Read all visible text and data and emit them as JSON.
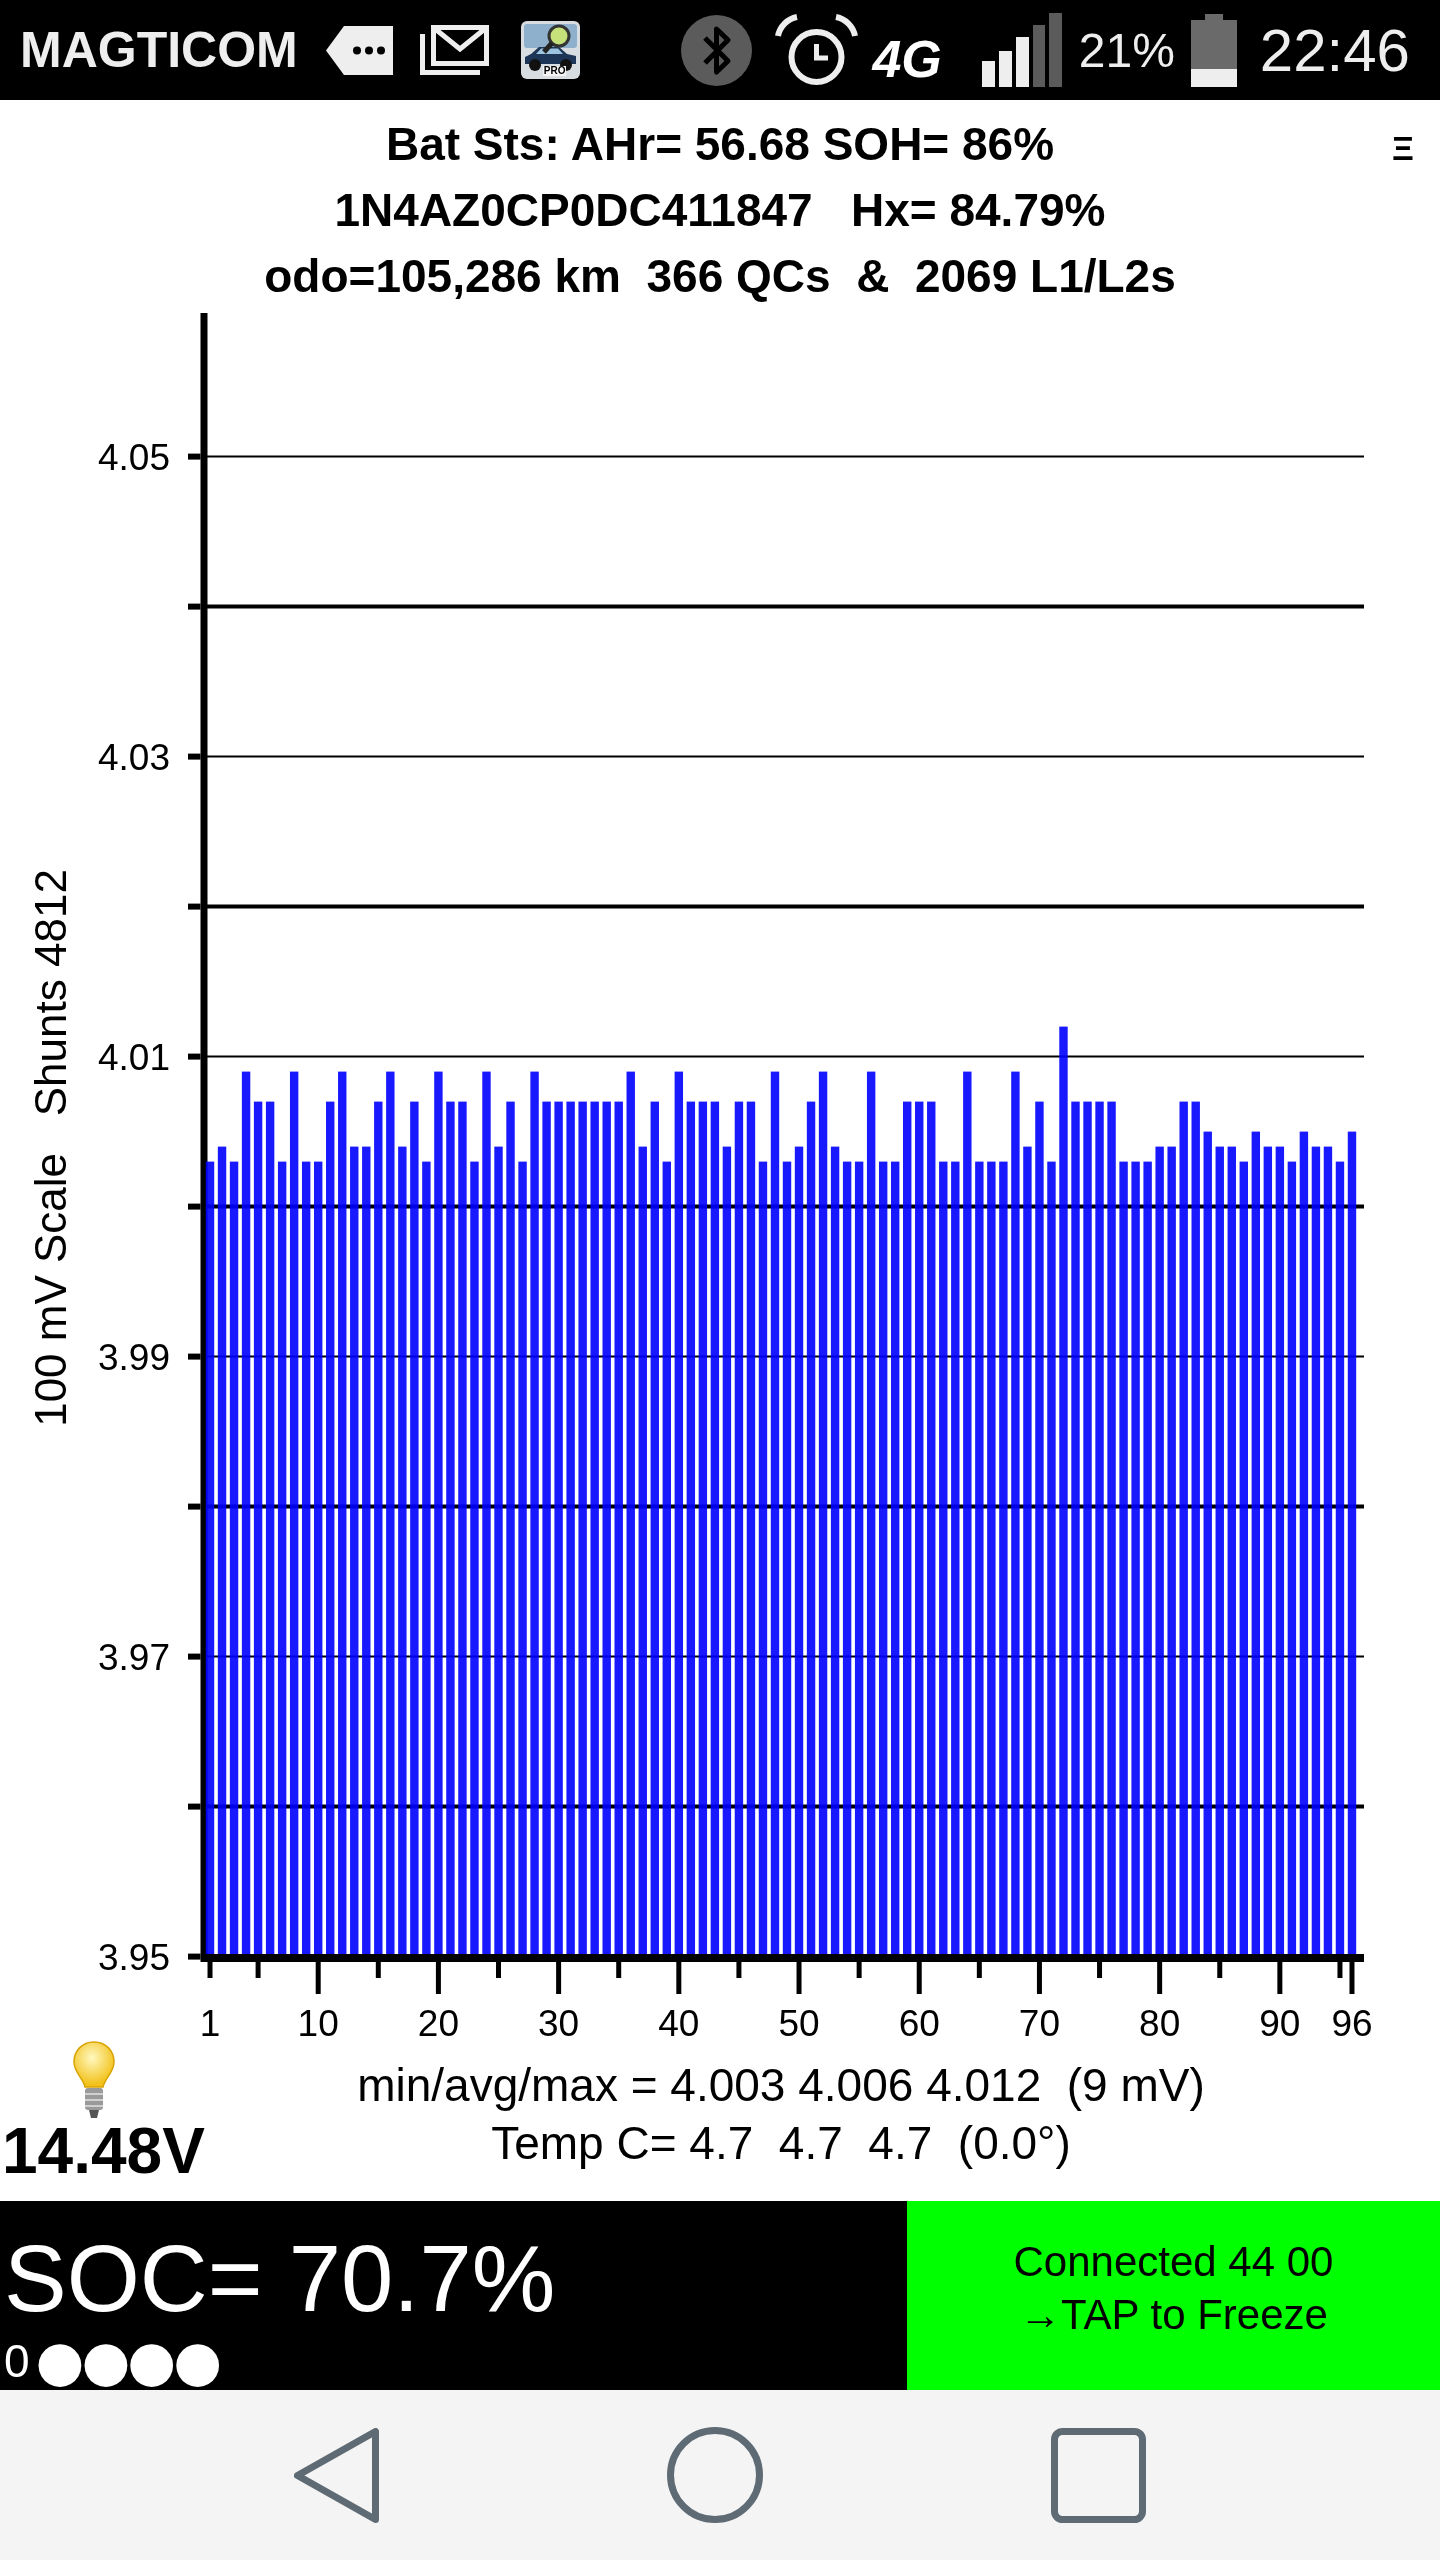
{
  "status_bar": {
    "carrier": "MAGTICOM",
    "app_badge": "PRO",
    "network": "4G",
    "battery": "21%",
    "time": "22:46"
  },
  "header": {
    "battery_status": "Bat Sts: AHr= 56.68 SOH= 86%",
    "vin_line": "1N4AZ0CP0DC411847   Hx= 84.79%",
    "odometer_line": "odo=105,286 km  366 QCs  &  2069 L1/L2s",
    "menu_glyph": "Ξ"
  },
  "chart": {
    "chart_data": {
      "type": "bar",
      "ylabel": "100 mV Scale   Shunts 4812",
      "x": [
        1,
        2,
        3,
        4,
        5,
        6,
        7,
        8,
        9,
        10,
        11,
        12,
        13,
        14,
        15,
        16,
        17,
        18,
        19,
        20,
        21,
        22,
        23,
        24,
        25,
        26,
        27,
        28,
        29,
        30,
        31,
        32,
        33,
        34,
        35,
        36,
        37,
        38,
        39,
        40,
        41,
        42,
        43,
        44,
        45,
        46,
        47,
        48,
        49,
        50,
        51,
        52,
        53,
        54,
        55,
        56,
        57,
        58,
        59,
        60,
        61,
        62,
        63,
        64,
        65,
        66,
        67,
        68,
        69,
        70,
        71,
        72,
        73,
        74,
        75,
        76,
        77,
        78,
        79,
        80,
        81,
        82,
        83,
        84,
        85,
        86,
        87,
        88,
        89,
        90,
        91,
        92,
        93,
        94,
        95,
        96
      ],
      "values": [
        4.003,
        4.004,
        4.003,
        4.009,
        4.007,
        4.007,
        4.003,
        4.009,
        4.003,
        4.003,
        4.007,
        4.009,
        4.004,
        4.004,
        4.007,
        4.009,
        4.004,
        4.007,
        4.003,
        4.009,
        4.007,
        4.007,
        4.003,
        4.009,
        4.004,
        4.007,
        4.003,
        4.009,
        4.007,
        4.007,
        4.007,
        4.007,
        4.007,
        4.007,
        4.007,
        4.009,
        4.004,
        4.007,
        4.003,
        4.009,
        4.007,
        4.007,
        4.007,
        4.004,
        4.007,
        4.007,
        4.003,
        4.009,
        4.003,
        4.004,
        4.007,
        4.009,
        4.004,
        4.003,
        4.003,
        4.009,
        4.003,
        4.003,
        4.007,
        4.007,
        4.007,
        4.003,
        4.003,
        4.009,
        4.003,
        4.003,
        4.003,
        4.009,
        4.004,
        4.007,
        4.003,
        4.012,
        4.007,
        4.007,
        4.007,
        4.007,
        4.003,
        4.003,
        4.003,
        4.004,
        4.004,
        4.007,
        4.007,
        4.005,
        4.004,
        4.004,
        4.003,
        4.005,
        4.004,
        4.004,
        4.003,
        4.005,
        4.004,
        4.004,
        4.003,
        4.005
      ],
      "xlim": [
        0.5,
        97
      ],
      "xticks": [
        1,
        10,
        20,
        30,
        40,
        50,
        60,
        70,
        80,
        90,
        96
      ],
      "yticks": [
        3.95,
        3.97,
        3.99,
        4.01,
        4.03,
        4.05
      ],
      "ylim": [
        3.95,
        4.06
      ],
      "grid": true
    }
  },
  "readings": {
    "voltage": "14.48V",
    "stats": "min/avg/max = 4.003 4.006 4.012  (9 mV)",
    "temperature": "Temp C= 4.7  4.7  4.7  (0.0°)"
  },
  "soc_bar": {
    "soc": "SOC= 70.7%",
    "indicator": "0",
    "dots": "●●●●",
    "status_button": [
      "Connected 44 00",
      "→TAP to Freeze"
    ]
  }
}
